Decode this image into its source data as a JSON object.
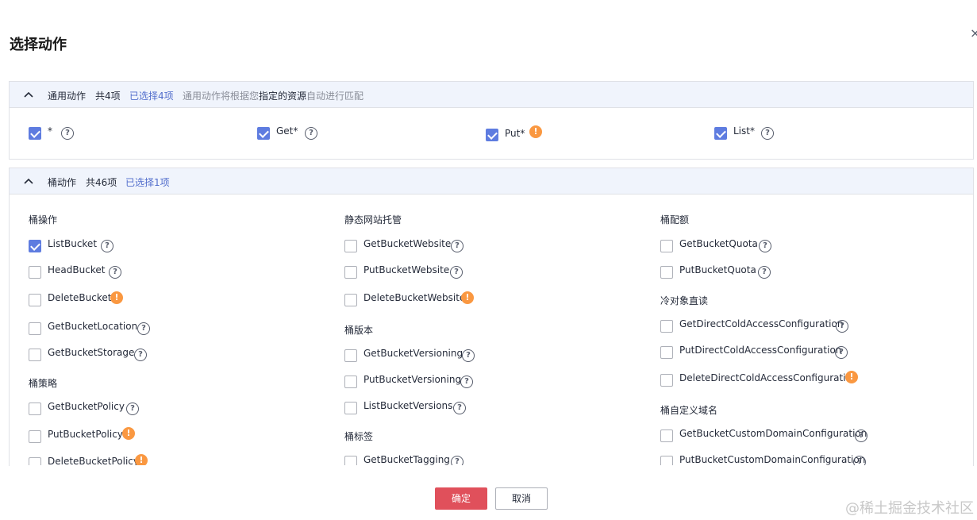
{
  "dialog": {
    "title": "选择动作",
    "close": "×"
  },
  "general": {
    "header": {
      "title": "通用动作",
      "count": "共4项",
      "selected": "已选择4项",
      "hint_prefix": "通用动作将根据您",
      "hint_strong": "指定的资源",
      "hint_suffix": "自动进行匹配"
    },
    "items": [
      {
        "label": "*",
        "checked": true,
        "icon": "help-icon"
      },
      {
        "label": "Get*",
        "checked": true,
        "icon": "help-icon"
      },
      {
        "label": "Put*",
        "checked": true,
        "icon": "warning-icon"
      },
      {
        "label": "List*",
        "checked": true,
        "icon": "help-icon"
      }
    ]
  },
  "bucket": {
    "header": {
      "title": "桶动作",
      "count": "共46项",
      "selected": "已选择1项"
    },
    "col1": {
      "group1": "桶操作",
      "g1_items": [
        "ListBucket",
        "HeadBucket",
        "DeleteBucket",
        "GetBucketLocation",
        "GetBucketStorage"
      ],
      "group2": "桶策略",
      "g2_items": [
        "GetBucketPolicy",
        "PutBucketPolicy",
        "DeleteBucketPolicy"
      ]
    },
    "col2": {
      "group1": "静态网站托管",
      "g1_items": [
        "GetBucketWebsite",
        "PutBucketWebsite",
        "DeleteBucketWebsite"
      ],
      "group2": "桶版本",
      "g2_items": [
        "GetBucketVersioning",
        "PutBucketVersioning",
        "ListBucketVersions"
      ],
      "group3": "桶标签",
      "g3_items": [
        "GetBucketTagging"
      ]
    },
    "col3": {
      "group1": "桶配额",
      "g1_items": [
        "GetBucketQuota",
        "PutBucketQuota"
      ],
      "group2": "冷对象直读",
      "g2_items": [
        "GetDirectColdAccessConfiguration",
        "PutDirectColdAccessConfiguration",
        "DeleteDirectColdAccessConfiguration"
      ],
      "group3": "桶自定义域名",
      "g3_items": [
        "GetBucketCustomDomainConfiguration",
        "PutBucketCustomDomainConfiguration"
      ]
    }
  },
  "footer": {
    "ok": "确定",
    "cancel": "取消"
  },
  "watermark": "@稀土掘金技术社区",
  "colors": {
    "primary": "#5e7ce0",
    "danger_button": "#e0505b",
    "warning": "#fa9841",
    "header_bg": "#f0f4fc"
  }
}
